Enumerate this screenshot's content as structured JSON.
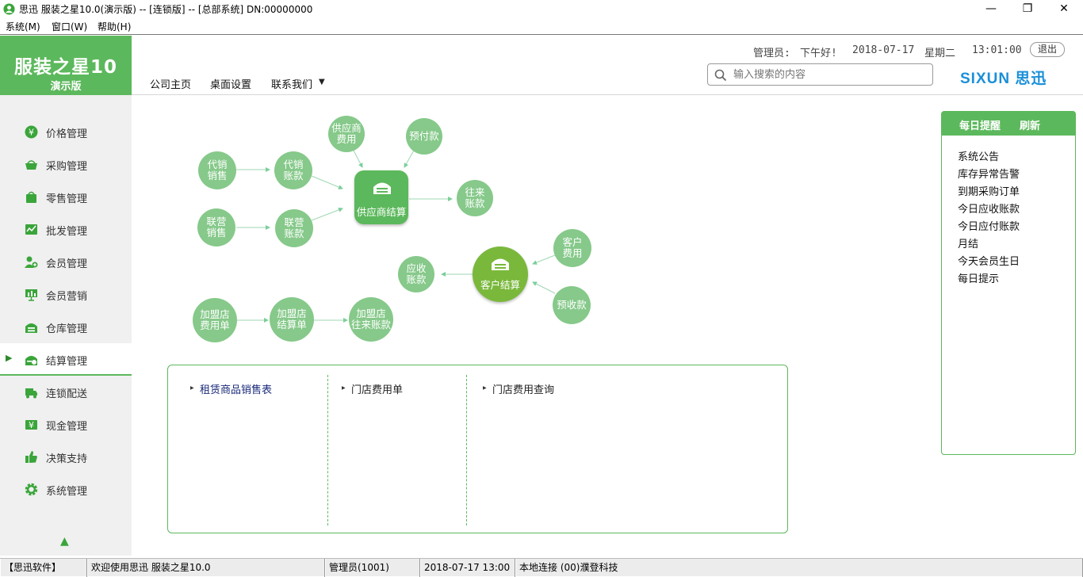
{
  "window": {
    "title": "思迅 服装之星10.0(演示版) -- [连锁版] -- [总部系统] DN:00000000",
    "min_glyph": "—",
    "max_glyph": "❐",
    "close_glyph": "✕"
  },
  "menubar": {
    "system": "系统(M)",
    "window": "窗口(W)",
    "help": "帮助(H)"
  },
  "logo": {
    "title": "服装之星10",
    "subtitle": "演示版"
  },
  "nav": {
    "home": "公司主页",
    "desktop": "桌面设置",
    "contact": "联系我们",
    "contact_arrow": "▼"
  },
  "header": {
    "admin": "管理员:",
    "greeting": "下午好!",
    "date": "2018-07-17",
    "weekday": "星期二",
    "time": "13:01:00",
    "logout": "退出",
    "search_placeholder": "输入搜索的内容",
    "brand": "SIXUN 思迅"
  },
  "sidebar": {
    "items": [
      {
        "label": "价格管理",
        "icon": "yen-icon"
      },
      {
        "label": "采购管理",
        "icon": "basket-icon"
      },
      {
        "label": "零售管理",
        "icon": "bag-icon"
      },
      {
        "label": "批发管理",
        "icon": "chart-icon"
      },
      {
        "label": "会员管理",
        "icon": "user-add-icon"
      },
      {
        "label": "会员营销",
        "icon": "presentation-icon"
      },
      {
        "label": "仓库管理",
        "icon": "warehouse-icon"
      },
      {
        "label": "结算管理",
        "icon": "settle-icon"
      },
      {
        "label": "连锁配送",
        "icon": "truck-icon"
      },
      {
        "label": "现金管理",
        "icon": "cash-icon"
      },
      {
        "label": "决策支持",
        "icon": "thumb-icon"
      },
      {
        "label": "系统管理",
        "icon": "gear-icon"
      }
    ],
    "active_index": 7
  },
  "diagram": {
    "supplier_hub": "供应商结算",
    "customer_hub": "客户结算",
    "nodes": {
      "supplier_fee_1": "供应商",
      "supplier_fee_2": "费用",
      "prepay": "预付款",
      "consign_sale_1": "代销",
      "consign_sale_2": "销售",
      "consign_acct_1": "代销",
      "consign_acct_2": "账款",
      "joint_sale_1": "联营",
      "joint_sale_2": "销售",
      "joint_acct_1": "联营",
      "joint_acct_2": "账款",
      "current_acct_1": "往来",
      "current_acct_2": "账款",
      "customer_fee_1": "客户",
      "customer_fee_2": "费用",
      "receivable_1": "应收",
      "receivable_2": "账款",
      "advance": "预收款",
      "franchise_fee_1": "加盟店",
      "franchise_fee_2": "费用单",
      "franchise_settle_1": "加盟店",
      "franchise_settle_2": "结算单",
      "franchise_acct_1": "加盟店",
      "franchise_acct_2": "往来账款"
    }
  },
  "links": {
    "col1": "租赁商品销售表",
    "col2": "门店费用单",
    "col3": "门店费用查询"
  },
  "reminder": {
    "title": "每日提醒",
    "refresh": "刷新",
    "items": [
      "系统公告",
      "库存异常告警",
      "到期采购订单",
      "今日应收账款",
      "今日应付账款",
      "月结",
      "今天会员生日",
      "每日提示"
    ]
  },
  "statusbar": {
    "company": "【思迅软件】",
    "welcome": "欢迎使用思迅 服装之星10.0",
    "user": "管理员(1001)",
    "datetime": "2018-07-17 13:00",
    "connection": "本地连接 (00)濮登科技"
  },
  "colors": {
    "accent": "#5cb85c",
    "node": "#86c98a",
    "brand": "#1a8fd8"
  }
}
